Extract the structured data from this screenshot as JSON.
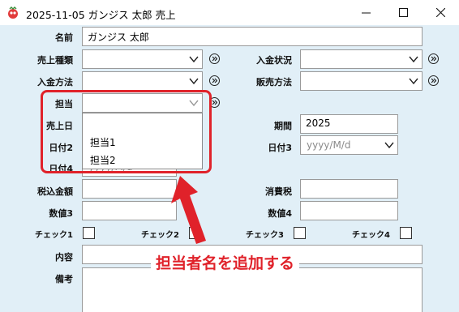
{
  "window": {
    "title": "2025-11-05 ガンジス 太郎 売上",
    "controls": {
      "minimize": "minimize-icon",
      "maximize": "maximize-icon",
      "close": "close-icon"
    }
  },
  "form": {
    "name": {
      "label": "名前",
      "value": "ガンジス 太郎"
    },
    "sale_type": {
      "label": "売上種類",
      "value": ""
    },
    "payment_status": {
      "label": "入金状況",
      "value": ""
    },
    "payment_method": {
      "label": "入金方法",
      "value": ""
    },
    "sales_method": {
      "label": "販売方法",
      "value": ""
    },
    "staff": {
      "label": "担当",
      "value": ""
    },
    "sale_date": {
      "label": "売上日"
    },
    "period": {
      "label": "期間",
      "value": "2025"
    },
    "date2": {
      "label": "日付2"
    },
    "date3": {
      "label": "日付3",
      "placeholder": "yyyy/M/d"
    },
    "date4": {
      "label": "日付4",
      "placeholder": "yyyy/M/d"
    },
    "tax_incl": {
      "label": "税込金額",
      "value": ""
    },
    "tax": {
      "label": "消費税",
      "value": ""
    },
    "num3": {
      "label": "数値3",
      "value": ""
    },
    "num4": {
      "label": "数値4",
      "value": ""
    },
    "check1": {
      "label": "チェック1",
      "checked": false
    },
    "check2": {
      "label": "チェック2",
      "checked": false
    },
    "check3": {
      "label": "チェック3",
      "checked": false
    },
    "check4": {
      "label": "チェック4",
      "checked": false
    },
    "content": {
      "label": "内容",
      "value": ""
    },
    "notes": {
      "label": "備考",
      "value": ""
    }
  },
  "staff_dropdown": {
    "options": [
      "担当1",
      "担当2"
    ]
  },
  "annotation": {
    "text": "担当者名を追加する",
    "color": "#e0222a"
  }
}
